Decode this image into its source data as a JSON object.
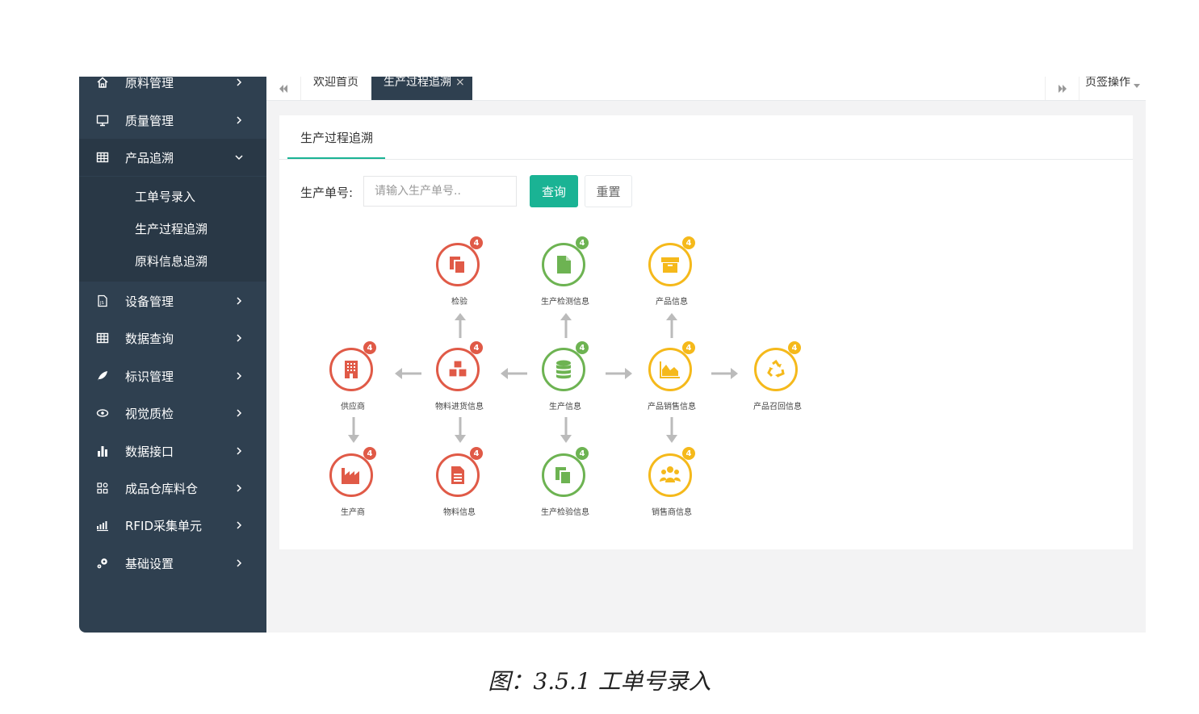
{
  "sidebar": {
    "items": [
      {
        "label": "原料管理",
        "icon": "home-icon"
      },
      {
        "label": "质量管理",
        "icon": "monitor-icon"
      },
      {
        "label": "产品追溯",
        "icon": "table-icon",
        "expanded": true
      },
      {
        "label": "设备管理",
        "icon": "js-file-icon"
      },
      {
        "label": "数据查询",
        "icon": "table-icon"
      },
      {
        "label": "标识管理",
        "icon": "leaf-icon"
      },
      {
        "label": "视觉质检",
        "icon": "eye-icon"
      },
      {
        "label": "数据接口",
        "icon": "bar-chart-icon"
      },
      {
        "label": "成品仓库料仓",
        "icon": "apps-icon"
      },
      {
        "label": "RFID采集单元",
        "icon": "signal-icon"
      },
      {
        "label": "基础设置",
        "icon": "gears-icon"
      }
    ],
    "subitems": [
      {
        "label": "工单号录入"
      },
      {
        "label": "生产过程追溯"
      },
      {
        "label": "原料信息追溯"
      }
    ]
  },
  "tabs": {
    "items": [
      {
        "label": "欢迎首页",
        "active": false
      },
      {
        "label": "生产过程追溯",
        "active": true,
        "close": "×"
      }
    ],
    "operations_label": "页签操作"
  },
  "panel": {
    "title": "生产过程追溯",
    "search_label": "生产单号:",
    "search_placeholder": "请输入生产单号..",
    "query_label": "查询",
    "reset_label": "重置"
  },
  "colors": {
    "red": "#e05a47",
    "green": "#6db352",
    "yellow": "#f5b91b",
    "sidebar": "#2f4050",
    "accent": "#1ab394"
  },
  "nodes": [
    {
      "id": "inspection",
      "label": "检验",
      "badge": "4",
      "color": "red",
      "icon": "copy-icon"
    },
    {
      "id": "production-test",
      "label": "生产检测信息",
      "badge": "4",
      "color": "green",
      "icon": "file-icon"
    },
    {
      "id": "product-info",
      "label": "产品信息",
      "badge": "4",
      "color": "yellow",
      "icon": "archive-icon"
    },
    {
      "id": "supplier",
      "label": "供应商",
      "badge": "4",
      "color": "red",
      "icon": "building-icon"
    },
    {
      "id": "material-purchase",
      "label": "物料进货信息",
      "badge": "4",
      "color": "red",
      "icon": "cubes-icon"
    },
    {
      "id": "production-info",
      "label": "生产信息",
      "badge": "4",
      "color": "green",
      "icon": "database-icon"
    },
    {
      "id": "product-sales",
      "label": "产品销售信息",
      "badge": "4",
      "color": "yellow",
      "icon": "area-chart-icon"
    },
    {
      "id": "product-recall",
      "label": "产品召回信息",
      "badge": "4",
      "color": "yellow",
      "icon": "recycle-icon"
    },
    {
      "id": "manufacturer",
      "label": "生产商",
      "badge": "4",
      "color": "red",
      "icon": "factory-icon"
    },
    {
      "id": "material-info",
      "label": "物料信息",
      "badge": "4",
      "color": "red",
      "icon": "document-icon"
    },
    {
      "id": "production-inspection",
      "label": "生产检验信息",
      "badge": "4",
      "color": "green",
      "icon": "copy-icon"
    },
    {
      "id": "dealer-info",
      "label": "销售商信息",
      "badge": "4",
      "color": "yellow",
      "icon": "users-icon"
    }
  ],
  "caption": "图：3.5.1 工单号录入"
}
